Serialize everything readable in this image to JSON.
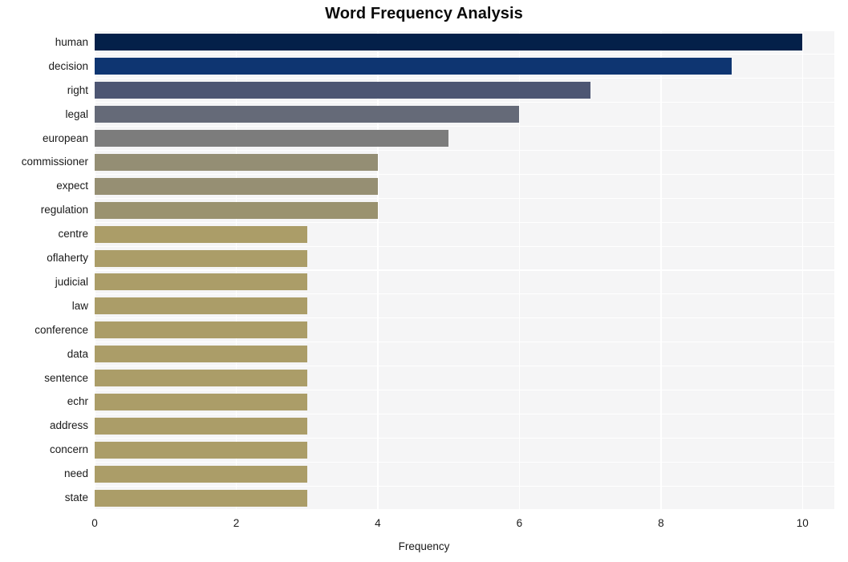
{
  "chart_data": {
    "type": "bar",
    "orientation": "horizontal",
    "title": "Word Frequency Analysis",
    "xlabel": "Frequency",
    "ylabel": "",
    "xlim": [
      0,
      10.45
    ],
    "xticks": [
      0,
      2,
      4,
      6,
      8,
      10
    ],
    "xtick_labels": [
      "0",
      "2",
      "4",
      "6",
      "8",
      "10"
    ],
    "grid": true,
    "grid_color": "#ffffff",
    "plot_background": "#f5f5f6",
    "figure_background": "#ffffff",
    "legend": "none",
    "categories": [
      "human",
      "decision",
      "right",
      "legal",
      "european",
      "commissioner",
      "expect",
      "regulation",
      "centre",
      "oflaherty",
      "judicial",
      "law",
      "conference",
      "data",
      "sentence",
      "echr",
      "address",
      "concern",
      "need",
      "state"
    ],
    "values": [
      10,
      9,
      7,
      6,
      5,
      4,
      4,
      4,
      3,
      3,
      3,
      3,
      3,
      3,
      3,
      3,
      3,
      3,
      3,
      3
    ],
    "bar_colors": [
      "#042049",
      "#0e3571",
      "#4d5673",
      "#656a78",
      "#7c7c7c",
      "#948e74",
      "#968f73",
      "#9a926f",
      "#ab9d68",
      "#ab9d68",
      "#ab9d68",
      "#ab9d68",
      "#ab9d68",
      "#ab9d68",
      "#ab9d68",
      "#ab9d68",
      "#ab9d68",
      "#ab9d68",
      "#ab9d68",
      "#ab9d68"
    ]
  }
}
